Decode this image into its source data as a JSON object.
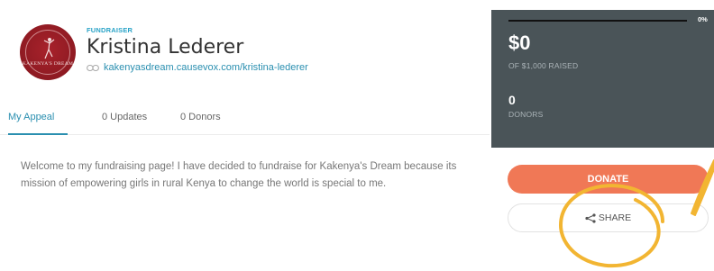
{
  "profile": {
    "role": "FUNDRAISER",
    "name": "Kristina Lederer",
    "url": "kakenyasdream.causevox.com/kristina-lederer",
    "avatar_text": "KAKENYA'S DREAM",
    "link_icon": "link-icon"
  },
  "tabs": [
    {
      "label": "My Appeal",
      "active": true
    },
    {
      "label": "0 Updates",
      "active": false
    },
    {
      "label": "0 Donors",
      "active": false
    }
  ],
  "appeal": {
    "text": "Welcome to my fundraising page! I have decided to fundraise for Kakenya's Dream because its mission of empowering girls in rural Kenya to change the world is special to me."
  },
  "stats": {
    "progress_label": "0%",
    "progress_fraction": 0,
    "raised": "$0",
    "raised_sub": "OF $1,000 RAISED",
    "donors": "0",
    "donors_sub": "DONORS"
  },
  "actions": {
    "donate_label": "DONATE",
    "share_label": "SHARE",
    "share_icon": "share-icon"
  },
  "colors": {
    "accent": "#2a8fb0",
    "stats_bg": "#4a5458",
    "donate": "#f07856",
    "annotation": "#f2b532"
  }
}
